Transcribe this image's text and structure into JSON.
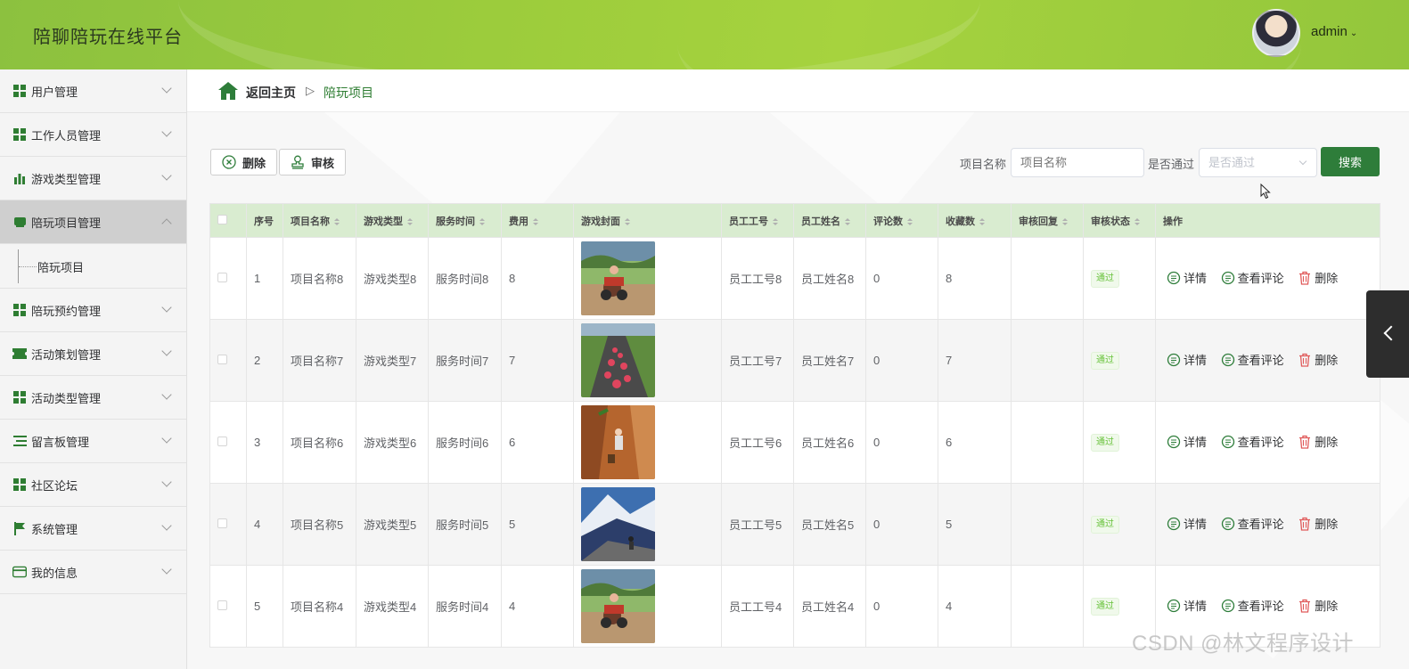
{
  "header": {
    "title": "陪聊陪玩在线平台",
    "username": "admin",
    "caret": "⌄"
  },
  "sidebar": {
    "items": [
      {
        "label": "用户管理",
        "icon": "grid-icon"
      },
      {
        "label": "工作人员管理",
        "icon": "grid-icon"
      },
      {
        "label": "游戏类型管理",
        "icon": "bar-chart-icon"
      },
      {
        "label": "陪玩项目管理",
        "icon": "store-icon",
        "active": true,
        "submenu": [
          "陪玩项目"
        ]
      },
      {
        "label": "陪玩预约管理",
        "icon": "grid-icon"
      },
      {
        "label": "活动策划管理",
        "icon": "ticket-icon"
      },
      {
        "label": "活动类型管理",
        "icon": "grid-icon"
      },
      {
        "label": "留言板管理",
        "icon": "list-icon"
      },
      {
        "label": "社区论坛",
        "icon": "grid-icon"
      },
      {
        "label": "系统管理",
        "icon": "flag-icon"
      },
      {
        "label": "我的信息",
        "icon": "card-icon"
      }
    ]
  },
  "breadcrumb": {
    "home": "返回主页",
    "separator": "▷",
    "current": "陪玩项目"
  },
  "toolbar": {
    "delete_label": "删除",
    "audit_label": "审核",
    "name_label": "项目名称",
    "name_placeholder": "项目名称",
    "pass_label": "是否通过",
    "pass_placeholder": "是否通过",
    "search_label": "搜索"
  },
  "table": {
    "columns": [
      "序号",
      "项目名称",
      "游戏类型",
      "服务时间",
      "费用",
      "游戏封面",
      "员工工号",
      "员工姓名",
      "评论数",
      "收藏数",
      "审核回复",
      "审核状态",
      "操作"
    ],
    "rows": [
      {
        "index": "1",
        "name": "项目名称8",
        "type": "游戏类型8",
        "time": "服务时间8",
        "fee": "8",
        "cover": "atv-field",
        "emp_no": "员工工号8",
        "emp_name": "员工姓名8",
        "comments": "0",
        "favorites": "8",
        "reply": "",
        "status": "通过"
      },
      {
        "index": "2",
        "name": "项目名称7",
        "type": "游戏类型7",
        "time": "服务时间7",
        "fee": "7",
        "cover": "road-runners",
        "emp_no": "员工工号7",
        "emp_name": "员工姓名7",
        "comments": "0",
        "favorites": "7",
        "reply": "",
        "status": "通过"
      },
      {
        "index": "3",
        "name": "项目名称6",
        "type": "游戏类型6",
        "time": "服务时间6",
        "fee": "6",
        "cover": "rock-climbing",
        "emp_no": "员工工号6",
        "emp_name": "员工姓名6",
        "comments": "0",
        "favorites": "6",
        "reply": "",
        "status": "通过"
      },
      {
        "index": "4",
        "name": "项目名称5",
        "type": "游戏类型5",
        "time": "服务时间5",
        "fee": "5",
        "cover": "mountain-hike",
        "emp_no": "员工工号5",
        "emp_name": "员工姓名5",
        "comments": "0",
        "favorites": "5",
        "reply": "",
        "status": "通过"
      },
      {
        "index": "5",
        "name": "项目名称4",
        "type": "游戏类型4",
        "time": "服务时间4",
        "fee": "4",
        "cover": "atv-field",
        "emp_no": "员工工号4",
        "emp_name": "员工姓名4",
        "comments": "0",
        "favorites": "4",
        "reply": "",
        "status": "通过"
      }
    ],
    "actions": {
      "detail": "详情",
      "view_comments": "查看评论",
      "delete": "删除"
    }
  },
  "watermark": "CSDN @林文程序设计",
  "colors": {
    "brand_green": "#2e7d3a",
    "header_green": "#9ccc3c",
    "table_header_bg": "#d9ecd0",
    "status_tag": "#67c23a",
    "delete_red": "#e05a5a"
  }
}
